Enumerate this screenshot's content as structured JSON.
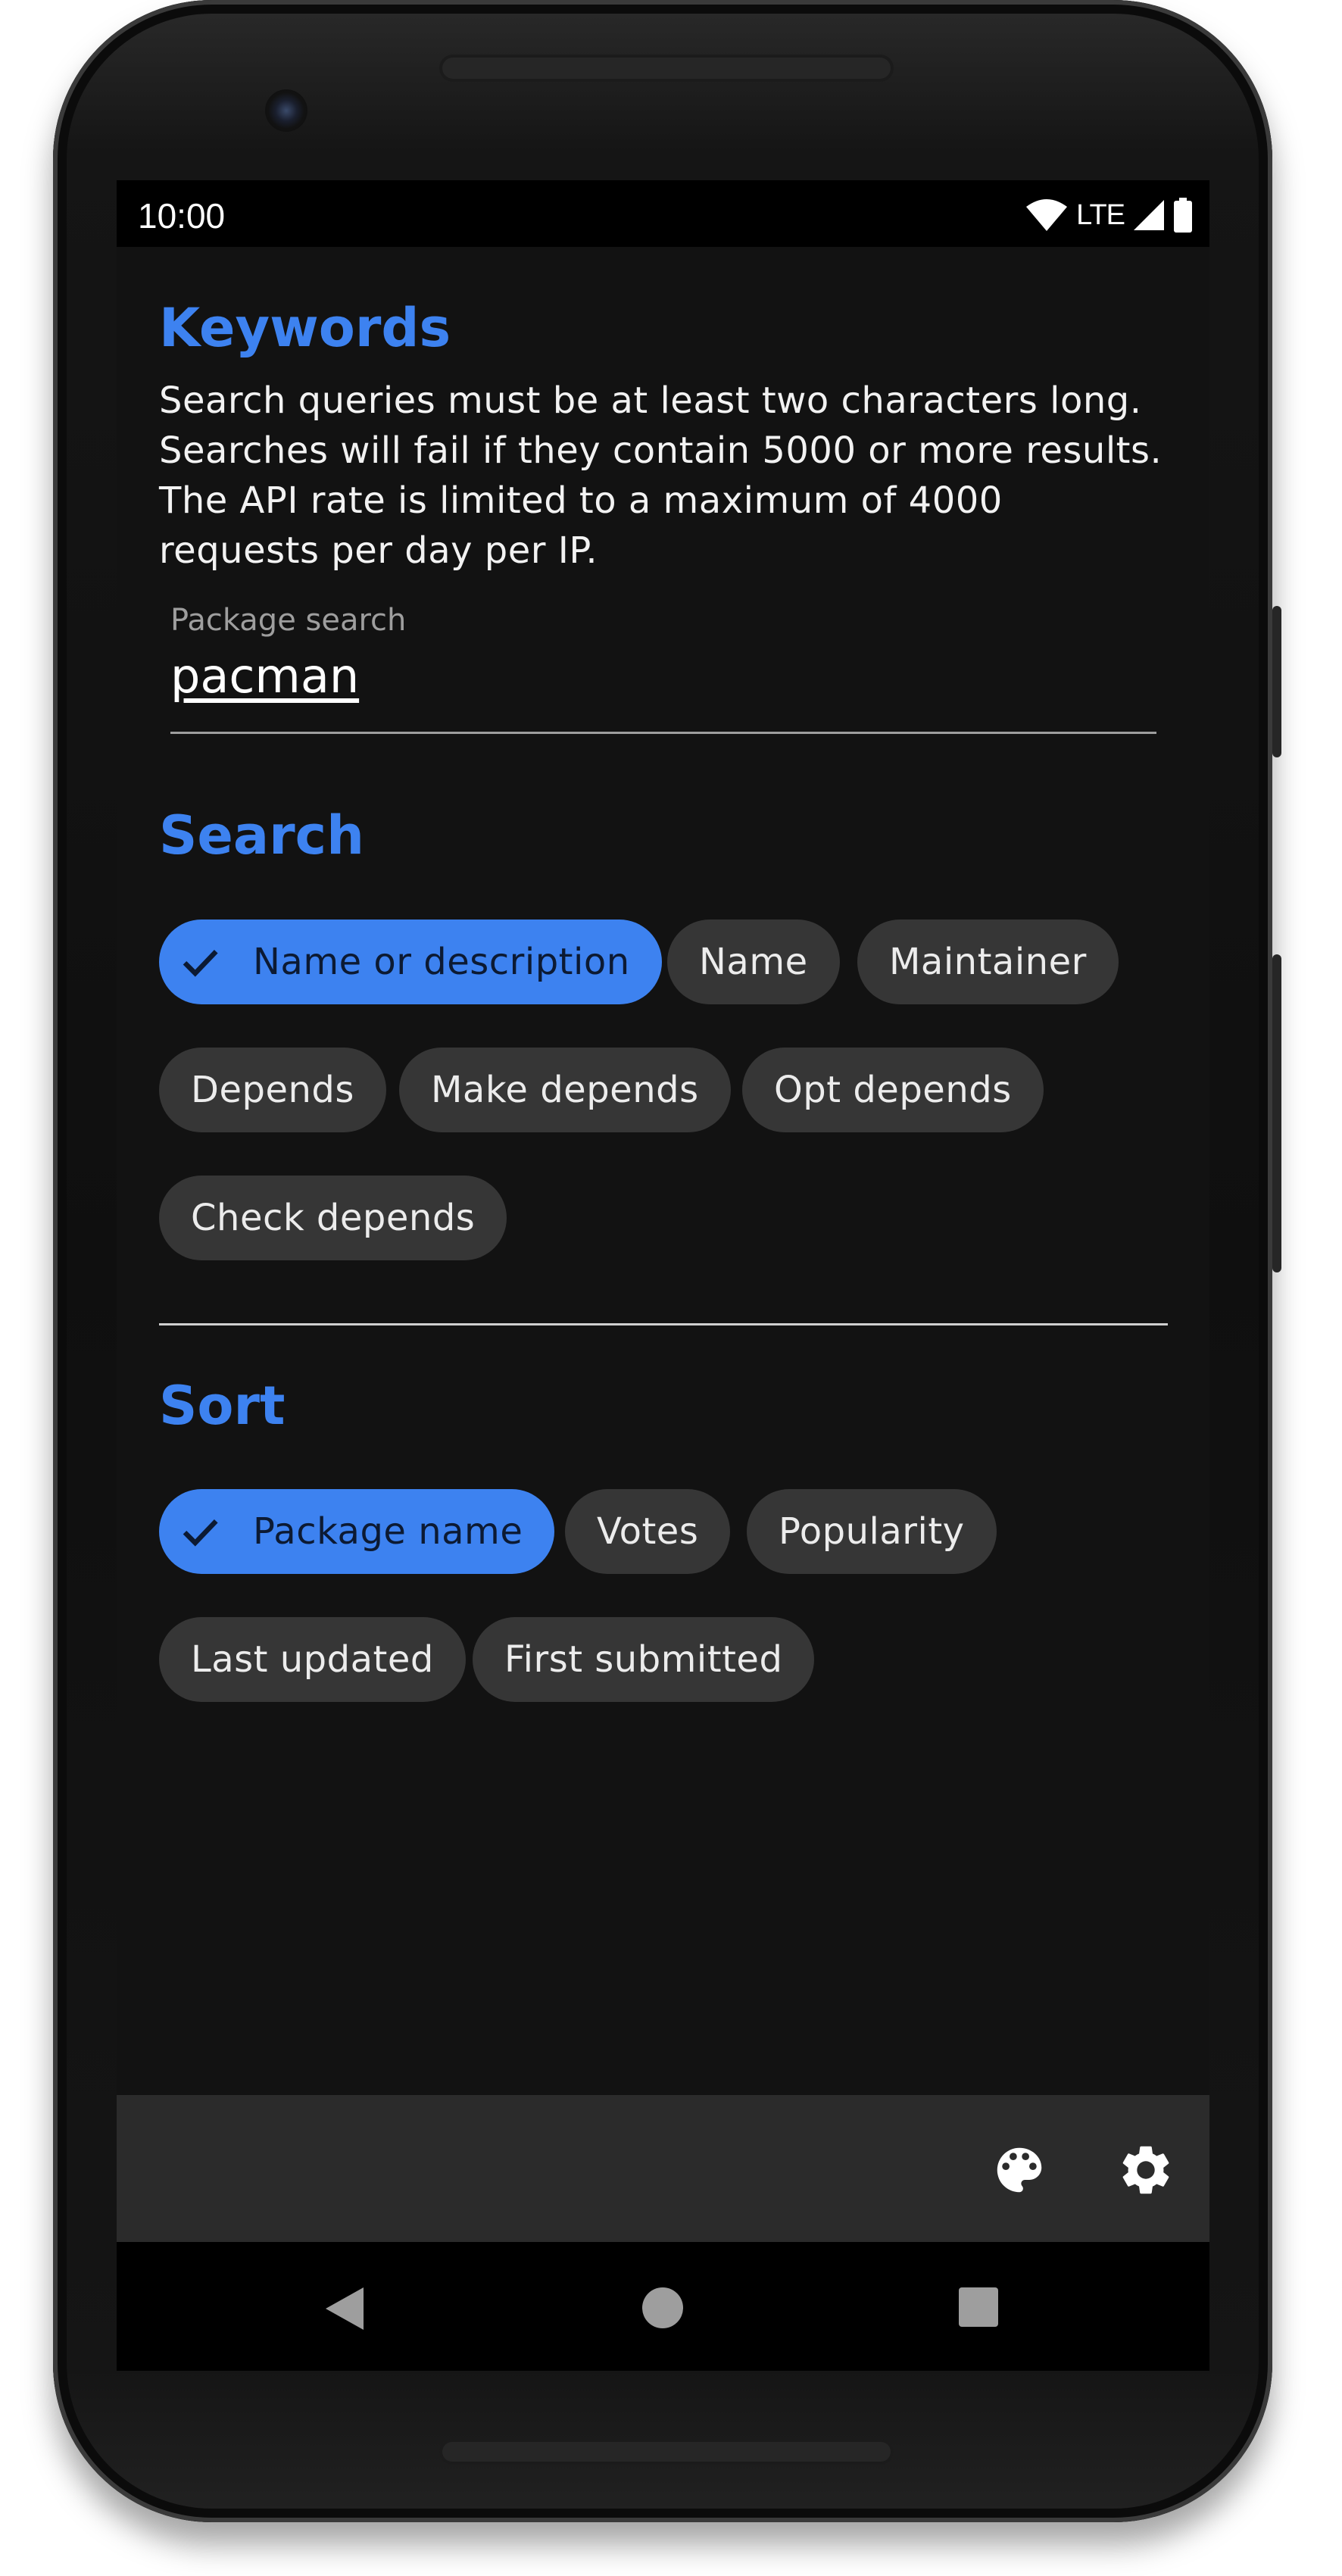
{
  "status_bar": {
    "time": "10:00",
    "network": "LTE"
  },
  "keywords": {
    "title": "Keywords",
    "description": "Search queries must be at least two characters long. Searches will fail if they contain 5000 or more results. The API rate is limited to a maximum of 4000 requests per day per IP.",
    "search_field": {
      "label": "Package search",
      "value": "pacman"
    }
  },
  "search": {
    "title": "Search",
    "chips": [
      {
        "label": "Name or description",
        "selected": true
      },
      {
        "label": "Name",
        "selected": false
      },
      {
        "label": "Maintainer",
        "selected": false
      },
      {
        "label": "Depends",
        "selected": false
      },
      {
        "label": "Make depends",
        "selected": false
      },
      {
        "label": "Opt depends",
        "selected": false
      },
      {
        "label": "Check depends",
        "selected": false
      }
    ]
  },
  "sort": {
    "title": "Sort",
    "chips": [
      {
        "label": "Package name",
        "selected": true
      },
      {
        "label": "Votes",
        "selected": false
      },
      {
        "label": "Popularity",
        "selected": false
      },
      {
        "label": "Last updated",
        "selected": false
      },
      {
        "label": "First submitted",
        "selected": false
      }
    ]
  },
  "bottom_bar": {
    "icons": [
      "palette-icon",
      "settings-gear-icon"
    ]
  },
  "nav_bar": {
    "icons": [
      "back-triangle-icon",
      "home-circle-icon",
      "recents-square-icon"
    ]
  },
  "colors": {
    "accent": "#3d82f0",
    "background": "#121212",
    "chip": "#363636",
    "bottom_bar": "#2b2b2b"
  }
}
